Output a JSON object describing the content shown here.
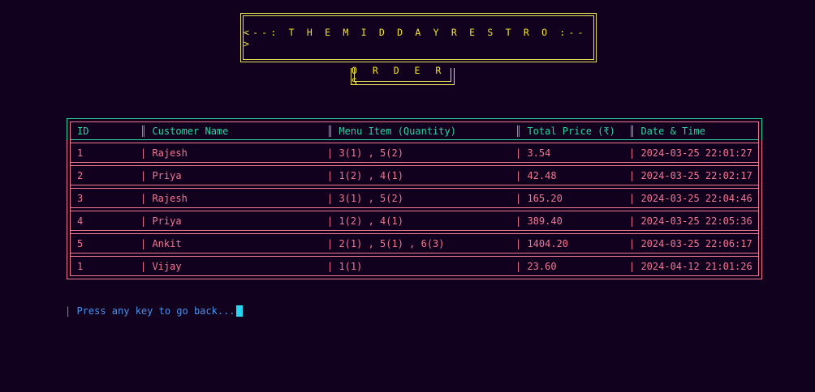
{
  "header": {
    "title": "<--: T H E   M I D D A Y   R E S T R O :-->",
    "subtitle": "O R D E R S"
  },
  "table": {
    "columns": [
      "ID",
      "║ Customer Name",
      "║ Menu Item (Quantity)",
      "║ Total Price (₹)",
      "║ Date & Time"
    ],
    "rows": [
      {
        "id": "1",
        "name": "| Rajesh",
        "menu": "| 3(1) , 5(2)",
        "price": "| 3.54",
        "date": "| 2024-03-25 22:01:27"
      },
      {
        "id": "2",
        "name": "| Priya",
        "menu": "| 1(2) , 4(1)",
        "price": "| 42.48",
        "date": "| 2024-03-25 22:02:17"
      },
      {
        "id": "3",
        "name": "| Rajesh",
        "menu": "| 3(1) , 5(2)",
        "price": "| 165.20",
        "date": "| 2024-03-25 22:04:46"
      },
      {
        "id": "4",
        "name": "| Priya",
        "menu": "| 1(2) , 4(1)",
        "price": "| 389.40",
        "date": "| 2024-03-25 22:05:36"
      },
      {
        "id": "5",
        "name": "| Ankit",
        "menu": "| 2(1) , 5(1) , 6(3)",
        "price": "| 1404.20",
        "date": "| 2024-03-25 22:06:17"
      },
      {
        "id": "1",
        "name": "| Vijay",
        "menu": "| 1(1)",
        "price": "| 23.60",
        "date": "| 2024-04-12 21:01:26"
      }
    ]
  },
  "footer": {
    "prompt": "| Press any key to go back..."
  },
  "colors": {
    "background": "#12001f",
    "title": "#f0e62e",
    "header_text": "#2fd3a0",
    "row_text": "#f17891",
    "prompt_text": "#4a93e8",
    "cursor": "#27d5f0"
  }
}
